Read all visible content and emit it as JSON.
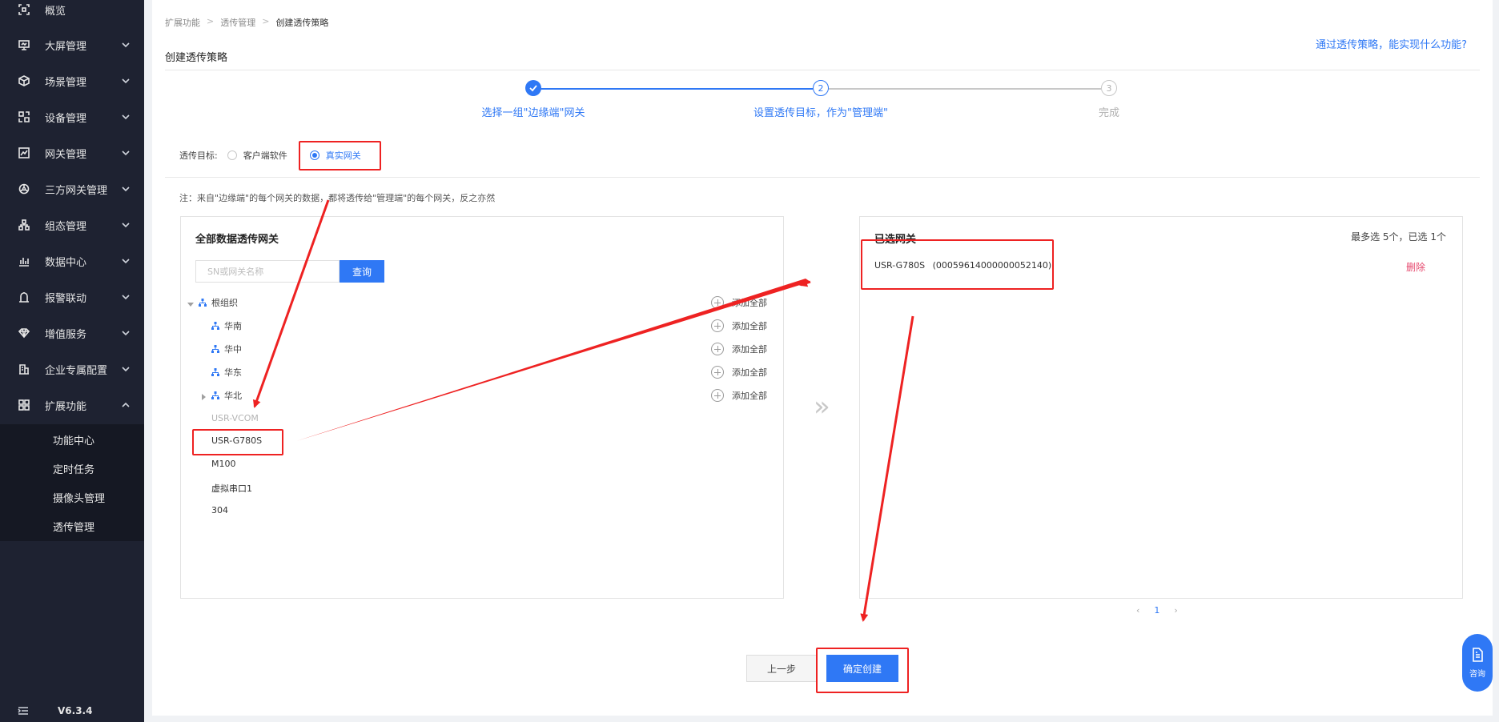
{
  "sidebar": {
    "items": [
      {
        "label": "概览",
        "icon": "overview-icon",
        "has_children": false
      },
      {
        "label": "大屏管理",
        "icon": "screen-icon",
        "has_children": true
      },
      {
        "label": "场景管理",
        "icon": "scene-icon",
        "has_children": true
      },
      {
        "label": "设备管理",
        "icon": "device-icon",
        "has_children": true
      },
      {
        "label": "网关管理",
        "icon": "gateway-icon",
        "has_children": true
      },
      {
        "label": "三方网关管理",
        "icon": "third-party-icon",
        "has_children": true
      },
      {
        "label": "组态管理",
        "icon": "config-icon",
        "has_children": true
      },
      {
        "label": "数据中心",
        "icon": "data-icon",
        "has_children": true
      },
      {
        "label": "报警联动",
        "icon": "alarm-icon",
        "has_children": true
      },
      {
        "label": "增值服务",
        "icon": "diamond-icon",
        "has_children": true
      },
      {
        "label": "企业专属配置",
        "icon": "enterprise-icon",
        "has_children": true
      },
      {
        "label": "扩展功能",
        "icon": "grid-icon",
        "has_children": true,
        "expanded": true
      }
    ],
    "sub_items": [
      "功能中心",
      "定时任务",
      "摄像头管理",
      "透传管理"
    ],
    "version": "V6.3.4"
  },
  "breadcrumb": [
    "扩展功能",
    "透传管理",
    "创建透传策略"
  ],
  "page_title": "创建透传策略",
  "help_link": "通过透传策略，能实现什么功能?",
  "steps": [
    {
      "index": "1",
      "label": "选择一组\"边缘端\"网关",
      "state": "done"
    },
    {
      "index": "2",
      "label": "设置透传目标，作为\"管理端\"",
      "state": "active"
    },
    {
      "index": "3",
      "label": "完成",
      "state": "pending"
    }
  ],
  "target": {
    "label": "透传目标:",
    "options": [
      "客户端软件",
      "真实网关"
    ],
    "selected": "真实网关"
  },
  "note": "注：来自\"边缘端\"的每个网关的数据，都将透传给\"管理端\"的每个网关，反之亦然",
  "left_panel": {
    "title": "全部数据透传网关",
    "search_placeholder": "SN或网关名称",
    "search_button": "查询",
    "tree": [
      {
        "label": "根组织",
        "level": 0,
        "expanded": true
      },
      {
        "label": "华南",
        "level": 1
      },
      {
        "label": "华中",
        "level": 1
      },
      {
        "label": "华东",
        "level": 1
      },
      {
        "label": "华北",
        "level": 1,
        "collapsed": true
      }
    ],
    "add_all_label": "添加全部",
    "devices": [
      {
        "label": "USR-VCOM",
        "disabled": true
      },
      {
        "label": "USR-G780S",
        "disabled": false
      },
      {
        "label": "M100",
        "disabled": false
      },
      {
        "label": "虚拟串口1",
        "disabled": false
      },
      {
        "label": "304",
        "disabled": false
      }
    ]
  },
  "right_panel": {
    "title": "已选网关",
    "limit_text": "最多选 5个，已选 1个",
    "selected": [
      {
        "name": "USR-G780S",
        "sn": "(00059614000000052140)"
      }
    ],
    "delete_label": "删除"
  },
  "pager": {
    "current": "1"
  },
  "buttons": {
    "prev": "上一步",
    "create": "确定创建"
  },
  "consult_label": "咨询",
  "colors": {
    "primary": "#2f78f5",
    "danger": "#e64a6f",
    "annotation": "#ee2222",
    "sidebar": "#1e2231"
  }
}
